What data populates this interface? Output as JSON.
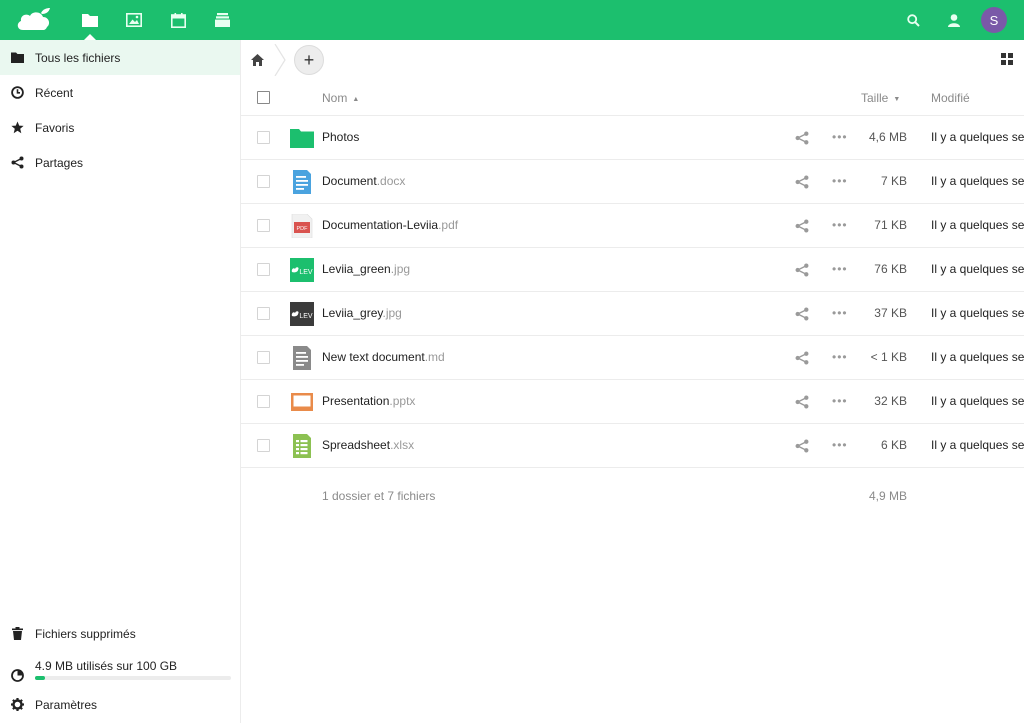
{
  "header": {
    "apps": [
      {
        "icon": "files-icon",
        "active": true
      },
      {
        "icon": "photos-icon",
        "active": false
      },
      {
        "icon": "calendar-icon",
        "active": false
      },
      {
        "icon": "deck-icon",
        "active": false
      }
    ],
    "user_initial": "S",
    "accent": "#1cbf6e",
    "avatar_color": "#7a59a8"
  },
  "sidebar": {
    "items": [
      {
        "label": "Tous les fichiers",
        "icon": "folder-icon"
      },
      {
        "label": "Récent",
        "icon": "clock-icon"
      },
      {
        "label": "Favoris",
        "icon": "star-icon"
      },
      {
        "label": "Partages",
        "icon": "share-icon"
      }
    ],
    "deleted_label": "Fichiers supprimés",
    "quota_label": "4.9 MB utilisés sur 100 GB",
    "quota_fraction": 0.05,
    "settings_label": "Paramètres"
  },
  "toolbar": {
    "new_label": "+"
  },
  "table": {
    "col_name": "Nom",
    "col_size": "Taille",
    "col_modified": "Modifié",
    "rows": [
      {
        "name": "Photos",
        "ext": "",
        "size": "4,6 MB",
        "modified": "Il y a quelques secondes",
        "type": "folder"
      },
      {
        "name": "Document",
        "ext": ".docx",
        "size": "7 KB",
        "modified": "Il y a quelques secondes",
        "type": "docx"
      },
      {
        "name": "Documentation-Leviia",
        "ext": ".pdf",
        "size": "71 KB",
        "modified": "Il y a quelques secondes",
        "type": "pdf"
      },
      {
        "name": "Leviia_green",
        "ext": ".jpg",
        "size": "76 KB",
        "modified": "Il y a quelques secondes",
        "type": "img-green"
      },
      {
        "name": "Leviia_grey",
        "ext": ".jpg",
        "size": "37 KB",
        "modified": "Il y a quelques secondes",
        "type": "img-grey"
      },
      {
        "name": "New text document",
        "ext": ".md",
        "size": "< 1 KB",
        "modified": "Il y a quelques secondes",
        "type": "md"
      },
      {
        "name": "Presentation",
        "ext": ".pptx",
        "size": "32 KB",
        "modified": "Il y a quelques secondes",
        "type": "pptx"
      },
      {
        "name": "Spreadsheet",
        "ext": ".xlsx",
        "size": "6 KB",
        "modified": "Il y a quelques secondes",
        "type": "xlsx"
      }
    ],
    "summary": "1 dossier et 7 fichiers",
    "summary_size": "4,9 MB",
    "pdf_badge": "PDF",
    "img_badge": "LEV"
  }
}
